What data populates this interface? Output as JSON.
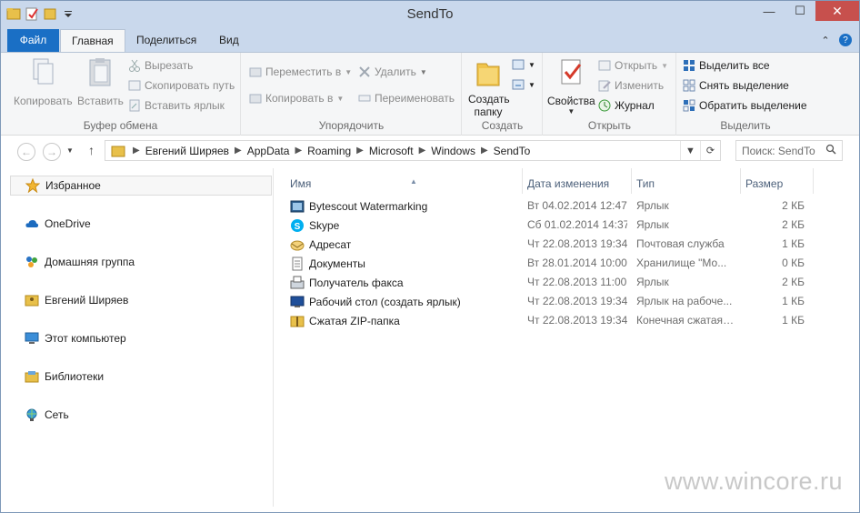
{
  "window": {
    "title": "SendTo",
    "controls": {
      "minimize": "—",
      "maximize": "☐",
      "close": "✕"
    }
  },
  "ribbon_tabs": {
    "file": "Файл",
    "home": "Главная",
    "share": "Поделиться",
    "view": "Вид"
  },
  "ribbon": {
    "clipboard": {
      "label": "Буфер обмена",
      "copy": "Копировать",
      "paste": "Вставить",
      "cut": "Вырезать",
      "copy_path": "Скопировать путь",
      "paste_shortcut": "Вставить ярлык"
    },
    "organize": {
      "label": "Упорядочить",
      "move_to": "Переместить в",
      "copy_to": "Копировать в",
      "delete": "Удалить",
      "rename": "Переименовать"
    },
    "new": {
      "label": "Создать",
      "new_folder": "Создать папку"
    },
    "open": {
      "label": "Открыть",
      "properties": "Свойства",
      "open": "Открыть",
      "edit": "Изменить",
      "history": "Журнал"
    },
    "select": {
      "label": "Выделить",
      "select_all": "Выделить все",
      "select_none": "Снять выделение",
      "invert": "Обратить выделение"
    }
  },
  "address": {
    "crumbs": [
      "Евгений Ширяев",
      "AppData",
      "Roaming",
      "Microsoft",
      "Windows",
      "SendTo"
    ],
    "search_placeholder": "Поиск: SendTo"
  },
  "nav": {
    "items": [
      {
        "label": "Избранное",
        "icon": "star-icon"
      },
      {
        "label": "OneDrive",
        "icon": "cloud-icon"
      },
      {
        "label": "Домашняя группа",
        "icon": "homegroup-icon"
      },
      {
        "label": "Евгений Ширяев",
        "icon": "user-folder-icon"
      },
      {
        "label": "Этот компьютер",
        "icon": "computer-icon"
      },
      {
        "label": "Библиотеки",
        "icon": "libraries-icon"
      },
      {
        "label": "Сеть",
        "icon": "network-icon"
      }
    ]
  },
  "columns": {
    "name": "Имя",
    "date": "Дата изменения",
    "type": "Тип",
    "size": "Размер"
  },
  "files": [
    {
      "name": "Bytescout Watermarking",
      "date": "Вт 04.02.2014 12:47",
      "type": "Ярлык",
      "size": "2 КБ",
      "icon": "watermark-app-icon"
    },
    {
      "name": "Skype",
      "date": "Сб 01.02.2014 14:37",
      "type": "Ярлык",
      "size": "2 КБ",
      "icon": "skype-icon"
    },
    {
      "name": "Адресат",
      "date": "Чт 22.08.2013 19:34",
      "type": "Почтовая служба",
      "size": "1 КБ",
      "icon": "mail-recipient-icon"
    },
    {
      "name": "Документы",
      "date": "Вт 28.01.2014 10:00",
      "type": "Хранилище \"Мо...",
      "size": "0 КБ",
      "icon": "documents-icon"
    },
    {
      "name": "Получатель факса",
      "date": "Чт 22.08.2013 11:00",
      "type": "Ярлык",
      "size": "2 КБ",
      "icon": "fax-icon"
    },
    {
      "name": "Рабочий стол (создать ярлык)",
      "date": "Чт 22.08.2013 19:34",
      "type": "Ярлык на рабоче...",
      "size": "1 КБ",
      "icon": "desktop-icon"
    },
    {
      "name": "Сжатая ZIP-папка",
      "date": "Чт 22.08.2013 19:34",
      "type": "Конечная сжатая ...",
      "size": "1 КБ",
      "icon": "zip-folder-icon"
    }
  ],
  "watermark": "www.wincore.ru"
}
